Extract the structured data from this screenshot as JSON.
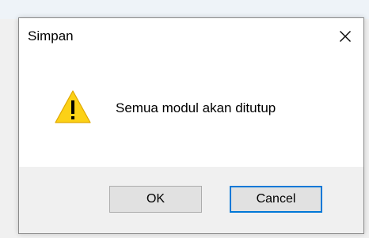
{
  "dialog": {
    "title": "Simpan",
    "message": "Semua modul akan ditutup",
    "icon": "warning-icon",
    "buttons": {
      "ok_label": "OK",
      "cancel_label": "Cancel",
      "default": "Cancel"
    }
  },
  "colors": {
    "warning_fill": "#fcd116",
    "focus_border": "#0078d7",
    "button_bar": "#f0f0f0"
  }
}
